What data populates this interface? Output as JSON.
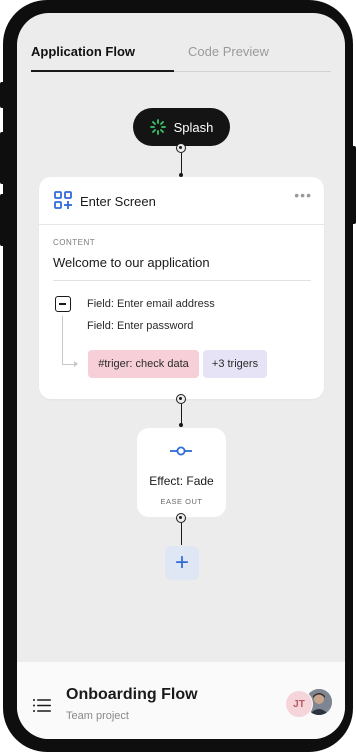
{
  "tabs": [
    {
      "label": "Application Flow",
      "active": true
    },
    {
      "label": "Code Preview",
      "active": false
    }
  ],
  "splash": {
    "label": "Splash",
    "icon": "loader-icon"
  },
  "enter_screen": {
    "title": "Enter Screen",
    "icon": "qr-add-icon",
    "menu": "•••",
    "content_label": "CONTENT",
    "content_value": "Welcome to our application",
    "fields": [
      "Field: Enter email address",
      "Field: Enter password"
    ],
    "tags": [
      "#triger: check data",
      "+3 trigers"
    ]
  },
  "effect": {
    "title": "Effect: Fade",
    "subtitle": "EASE OUT",
    "icon": "slider-node-icon"
  },
  "add_button": {
    "label": "+"
  },
  "footer": {
    "title": "Onboarding Flow",
    "subtitle": "Team project",
    "avatar_initials": "JT"
  },
  "colors": {
    "accent_blue": "#2f6bd8",
    "splash_bg": "#141414",
    "loader_green": "#37c96d",
    "tag_pink": "#f7cfd8",
    "tag_lilac": "#e5e3f5"
  }
}
